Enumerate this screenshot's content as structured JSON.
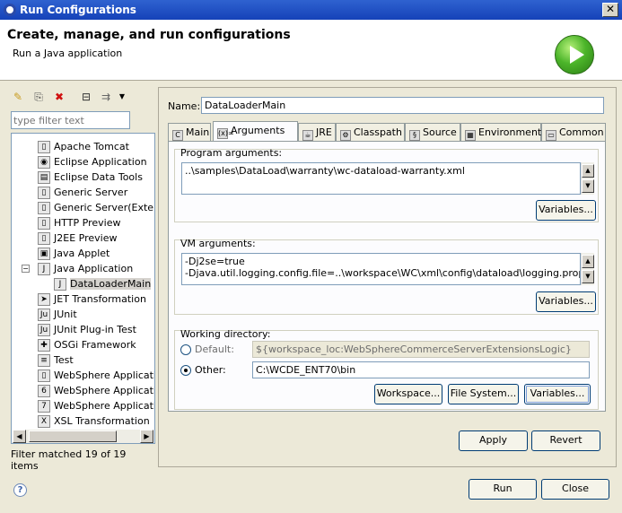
{
  "window": {
    "title": "Run Configurations",
    "close_glyph": "✕"
  },
  "banner": {
    "title": "Create, manage, and run configurations",
    "subtitle": "Run a Java application",
    "icon": "run-icon"
  },
  "left": {
    "filter_placeholder": "type filter text",
    "tree": [
      {
        "label": "Apache Tomcat",
        "icon": "server-icon",
        "glyph": "▯"
      },
      {
        "label": "Eclipse Application",
        "icon": "eclipse-icon",
        "glyph": "◉"
      },
      {
        "label": "Eclipse Data Tools",
        "icon": "database-icon",
        "glyph": "▤"
      },
      {
        "label": "Generic Server",
        "icon": "server-icon",
        "glyph": "▯"
      },
      {
        "label": "Generic Server(Externa",
        "icon": "server-icon",
        "glyph": "▯"
      },
      {
        "label": "HTTP Preview",
        "icon": "server-icon",
        "glyph": "▯"
      },
      {
        "label": "J2EE Preview",
        "icon": "server-icon",
        "glyph": "▯"
      },
      {
        "label": "Java Applet",
        "icon": "applet-icon",
        "glyph": "▣"
      },
      {
        "label": "Java Application",
        "icon": "java-app-icon",
        "glyph": "J",
        "expanded": true
      },
      {
        "label": "DataLoaderMain",
        "icon": "java-app-icon",
        "glyph": "J",
        "child": true,
        "selected": true
      },
      {
        "label": "JET Transformation",
        "icon": "jet-icon",
        "glyph": "➤"
      },
      {
        "label": "JUnit",
        "icon": "junit-icon",
        "glyph": "Ju"
      },
      {
        "label": "JUnit Plug-in Test",
        "icon": "junit-plugin-icon",
        "glyph": "Ju"
      },
      {
        "label": "OSGi Framework",
        "icon": "osgi-icon",
        "glyph": "✚"
      },
      {
        "label": "Test",
        "icon": "test-icon",
        "glyph": "≡"
      },
      {
        "label": "WebSphere Application",
        "icon": "websphere-icon",
        "glyph": "▯"
      },
      {
        "label": "WebSphere Application",
        "icon": "websphere-6-icon",
        "glyph": "6"
      },
      {
        "label": "WebSphere Application",
        "icon": "websphere-7-icon",
        "glyph": "7"
      },
      {
        "label": "XSL Transformation",
        "icon": "xsl-icon",
        "glyph": "X"
      }
    ],
    "status": "Filter matched 19 of 19 items"
  },
  "right": {
    "name_label": "Name:",
    "name_value": "DataLoaderMain",
    "tabs": [
      {
        "label": "Main",
        "icon": "main-tab-icon",
        "glyph": "C"
      },
      {
        "label": "Arguments",
        "icon": "arguments-tab-icon",
        "glyph": "(x)="
      },
      {
        "label": "JRE",
        "icon": "jre-tab-icon",
        "glyph": "☕"
      },
      {
        "label": "Classpath",
        "icon": "classpath-tab-icon",
        "glyph": "⚙"
      },
      {
        "label": "Source",
        "icon": "source-tab-icon",
        "glyph": "§"
      },
      {
        "label": "Environment",
        "icon": "environment-tab-icon",
        "glyph": "▦"
      },
      {
        "label": "Common",
        "icon": "common-tab-icon",
        "glyph": "▭"
      }
    ],
    "program_args": {
      "label": "Program arguments:",
      "value": "..\\samples\\DataLoad\\warranty\\wc-dataload-warranty.xml",
      "variables": "Variables..."
    },
    "vm_args": {
      "label": "VM arguments:",
      "value": "-Dj2se=true\n-Djava.util.logging.config.file=..\\workspace\\WC\\xml\\config\\dataload\\logging.properties",
      "variables": "Variables..."
    },
    "working_dir": {
      "label": "Working directory:",
      "default_label": "Default:",
      "default_value": "${workspace_loc:WebSphereCommerceServerExtensionsLogic}",
      "other_label": "Other:",
      "other_value": "C:\\WCDE_ENT70\\bin",
      "workspace_btn": "Workspace...",
      "filesystem_btn": "File System...",
      "variables_btn": "Variables..."
    },
    "apply": "Apply",
    "revert": "Revert"
  },
  "footer": {
    "help_glyph": "?",
    "run": "Run",
    "close": "Close"
  }
}
